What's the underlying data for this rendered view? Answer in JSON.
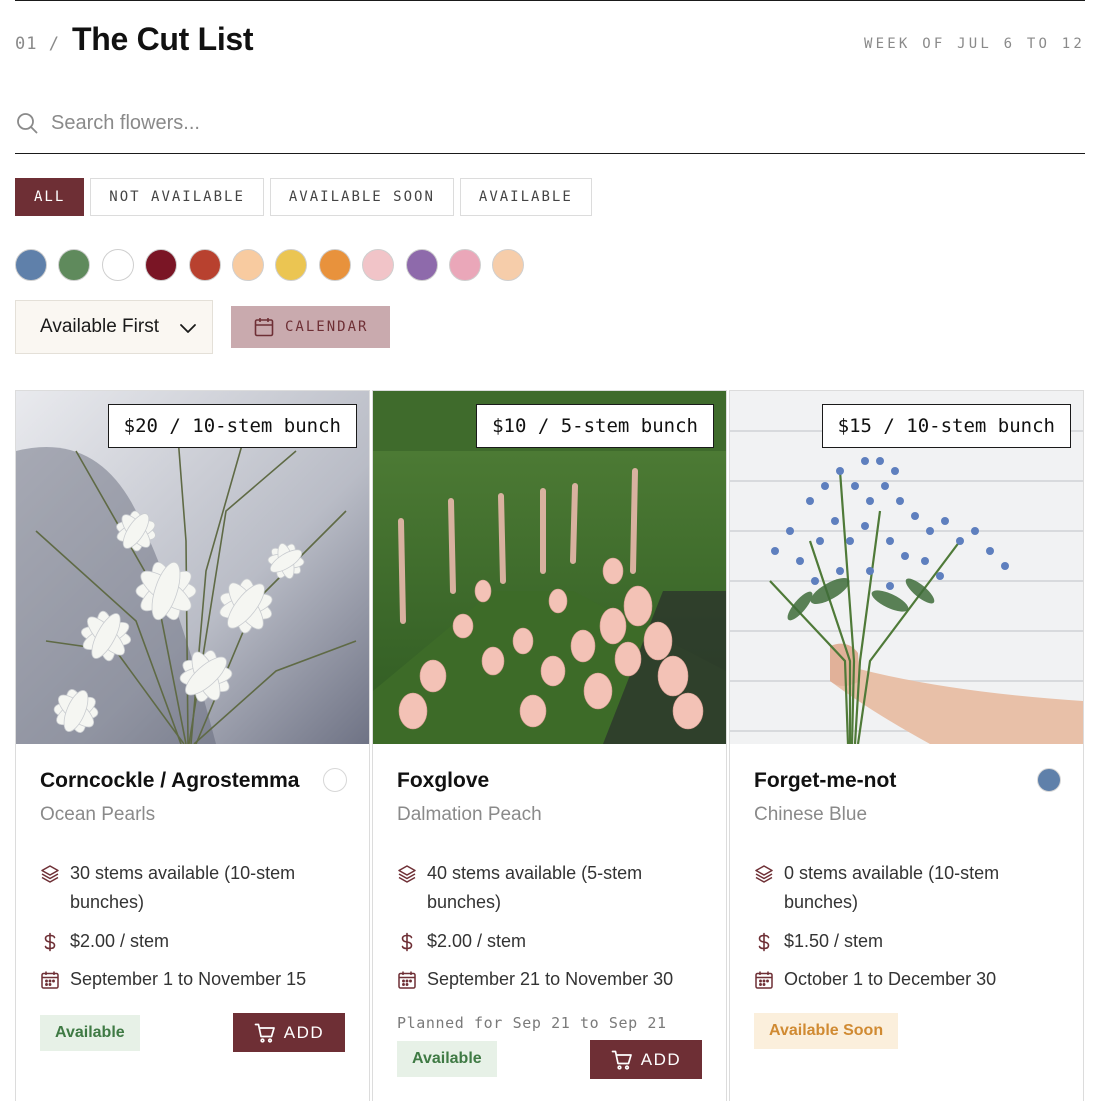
{
  "header": {
    "section_number": "01 /",
    "title": "The Cut List",
    "week": "WEEK OF JUL 6 TO 12"
  },
  "search": {
    "placeholder": "Search flowers...",
    "value": ""
  },
  "filters": [
    {
      "label": "ALL",
      "active": true
    },
    {
      "label": "NOT AVAILABLE",
      "active": false
    },
    {
      "label": "AVAILABLE SOON",
      "active": false
    },
    {
      "label": "AVAILABLE",
      "active": false
    }
  ],
  "color_swatches": [
    "#5f80aa",
    "#5f8a5c",
    "#ffffff",
    "#7a1525",
    "#b8412f",
    "#f8cba0",
    "#ebc552",
    "#e8923c",
    "#f1c4c8",
    "#8e6aab",
    "#eaa7b9",
    "#f6cdaa"
  ],
  "sort": {
    "label": "Available First"
  },
  "calendar_button": {
    "label": "CALENDAR"
  },
  "cards": [
    {
      "price_tag": "$20 / 10-stem bunch",
      "name": "Corncockle / Agrostemma",
      "variety": "Ocean Pearls",
      "dot_color": "#ffffff",
      "stems": "30 stems available (10-stem bunches)",
      "price_per_stem": "$2.00 / stem",
      "season": "September 1 to November 15",
      "planned": "",
      "status": "Available",
      "add_label": "ADD"
    },
    {
      "price_tag": "$10 / 5-stem bunch",
      "name": "Foxglove",
      "variety": "Dalmation Peach",
      "dot_color": "",
      "stems": "40 stems available (5-stem bunches)",
      "price_per_stem": "$2.00 / stem",
      "season": "September 21 to November 30",
      "planned": "Planned for Sep 21 to Sep 21",
      "status": "Available",
      "add_label": "ADD"
    },
    {
      "price_tag": "$15 / 10-stem bunch",
      "name": "Forget-me-not",
      "variety": "Chinese Blue",
      "dot_color": "#5f80aa",
      "stems": "0 stems available (10-stem bunches)",
      "price_per_stem": "$1.50 / stem",
      "season": "October 1 to December 30",
      "planned": "",
      "status": "Available Soon",
      "add_label": ""
    }
  ]
}
